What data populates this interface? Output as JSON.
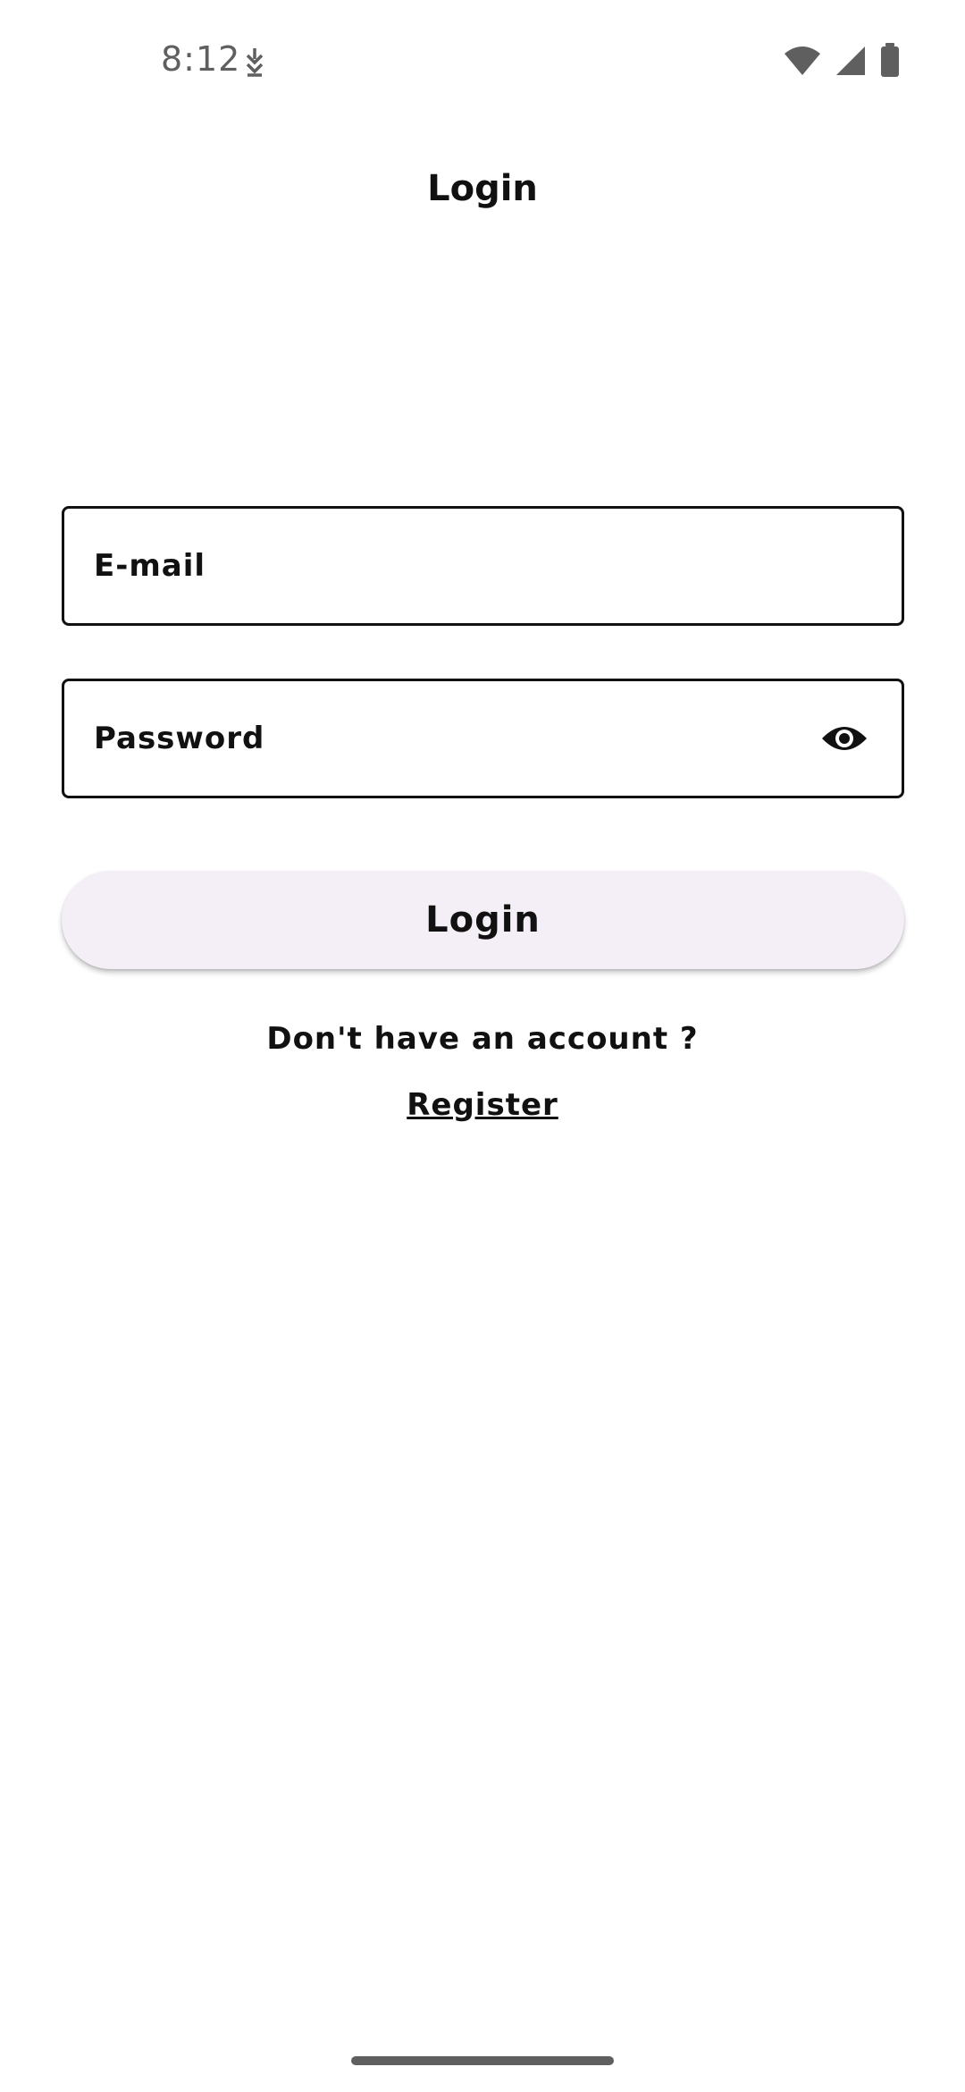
{
  "status_bar": {
    "time": "8:12",
    "notification_icon": "download-arrow-icon",
    "icons": [
      "wifi-icon",
      "cellular-signal-icon",
      "battery-icon"
    ],
    "icon_color": "#5f5f5f"
  },
  "header": {
    "title": "Login"
  },
  "form": {
    "email": {
      "label": "E-mail",
      "value": ""
    },
    "password": {
      "label": "Password",
      "value": "",
      "toggle_icon": "eye-icon"
    },
    "login_button_label": "Login",
    "no_account_text": "Don't have an account ?",
    "register_link_label": "Register"
  },
  "colors": {
    "text": "#111111",
    "button_background": "#f4eff7",
    "background": "#ffffff"
  }
}
